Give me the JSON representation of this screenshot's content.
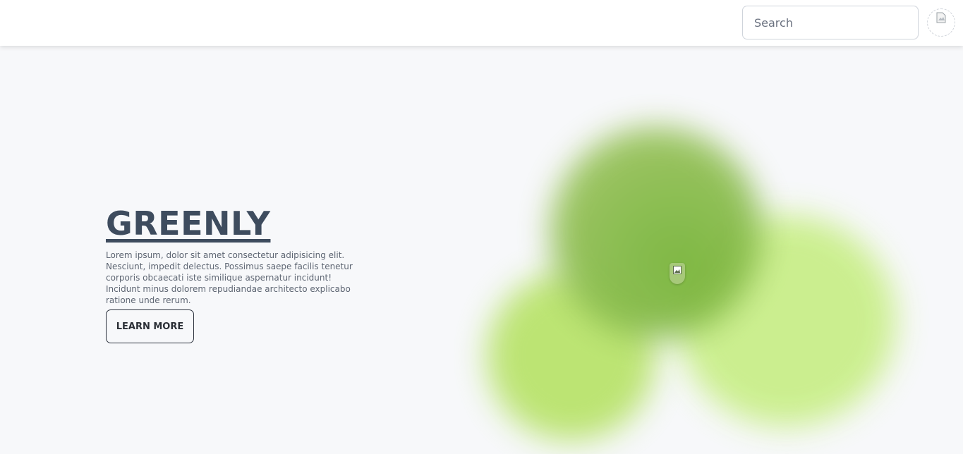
{
  "header": {
    "search": {
      "placeholder": "Search",
      "value": ""
    },
    "avatar": {
      "icon": "broken-image-icon"
    }
  },
  "hero": {
    "title": "GREENLY",
    "description": "Lorem ipsum, dolor sit amet consectetur adipisicing elit. Nesciunt, impedit delectus. Possimus saepe facilis tenetur corporis obcaecati iste similique aspernatur incidunt! Incidunt minus dolorem repudiandae architecto explicabo ratione unde rerum.",
    "cta_label": "LEARN MORE"
  },
  "illustration": {
    "icon": "broken-image-icon",
    "colors": {
      "dark_green": "#8bbd4f",
      "light_green": "#c8ee86",
      "lime": "#b9e36c"
    }
  },
  "colors": {
    "title": "#3e4c5e",
    "background": "#f7f8fa"
  }
}
